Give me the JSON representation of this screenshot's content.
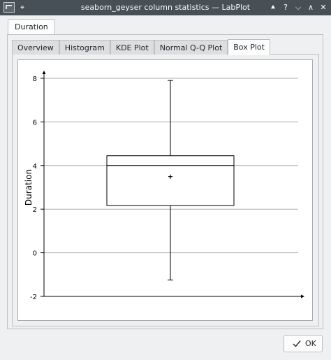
{
  "window": {
    "title": "seaborn_geyser column statistics — LabPlot",
    "pin_icon": "pin-icon",
    "buttons": [
      "keep-above-icon",
      "help-icon",
      "minimize-icon",
      "maximize-icon",
      "close-icon"
    ]
  },
  "outer_tabs": [
    {
      "label": "Duration",
      "active": true
    }
  ],
  "inner_tabs": [
    {
      "label": "Overview",
      "active": false
    },
    {
      "label": "Histogram",
      "active": false
    },
    {
      "label": "KDE Plot",
      "active": false
    },
    {
      "label": "Normal Q-Q Plot",
      "active": false
    },
    {
      "label": "Box Plot",
      "active": true
    }
  ],
  "chart_data": {
    "type": "box",
    "ylabel": "Duration",
    "xlabel": "",
    "title": "",
    "ylim": [
      -2,
      8
    ],
    "yticks": [
      -2,
      0,
      2,
      4,
      6,
      8
    ],
    "grid": true,
    "box": {
      "whisker_low": -1.25,
      "q1": 2.17,
      "median": 4.0,
      "q3": 4.45,
      "whisker_high": 7.9,
      "mean": 3.49
    }
  },
  "buttons": {
    "ok_label": "OK"
  },
  "colors": {
    "titlebar": "#475057",
    "background": "#eff0f1",
    "plot_background": "#ffffff"
  }
}
